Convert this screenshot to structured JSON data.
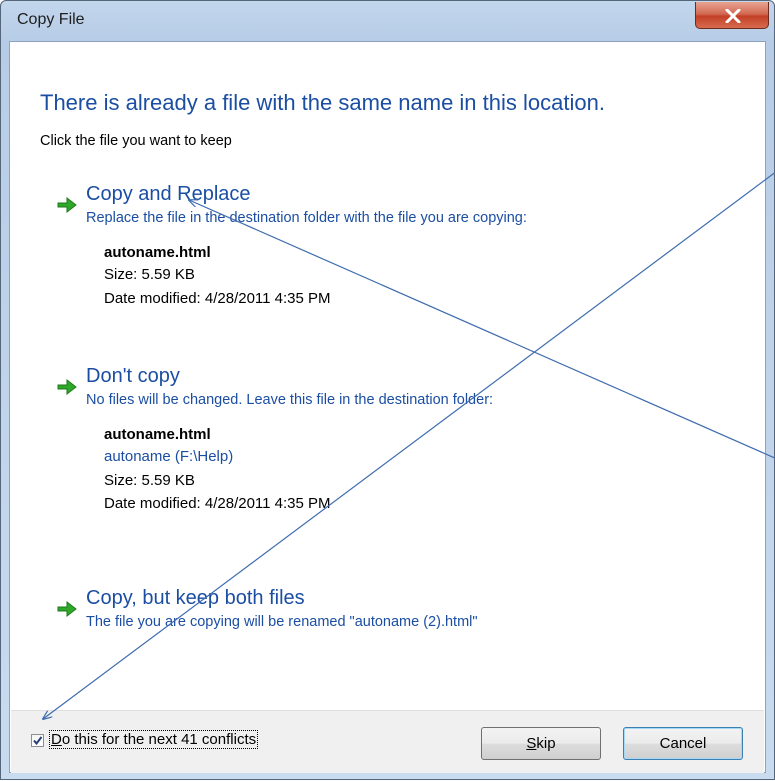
{
  "window": {
    "title": "Copy File"
  },
  "dialog": {
    "heading": "There is already a file with the same name in this location.",
    "subheading": "Click the file you want to keep"
  },
  "options": [
    {
      "title": "Copy and Replace",
      "description": "Replace the file in the destination folder with the file you are copying:",
      "file_name": "autoname.html",
      "size": "Size: 5.59 KB",
      "date": "Date modified: 4/28/2011 4:35 PM"
    },
    {
      "title": "Don't copy",
      "description": "No files will be changed. Leave this file in the destination folder:",
      "file_name": "autoname.html",
      "location": "autoname (F:\\Help)",
      "size": "Size: 5.59 KB",
      "date": "Date modified: 4/28/2011 4:35 PM"
    },
    {
      "title": "Copy, but keep both files",
      "description": "The file you are copying will be renamed \"autoname (2).html\""
    }
  ],
  "footer": {
    "checkbox_label": "Do this for the next 41 conflicts",
    "checkbox_checked": true,
    "skip_label": "Skip",
    "cancel_label": "Cancel"
  },
  "colors": {
    "link_blue": "#1b4ea3",
    "arrow_green": "#2fa82a",
    "annotation_line": "#3f6cae"
  }
}
